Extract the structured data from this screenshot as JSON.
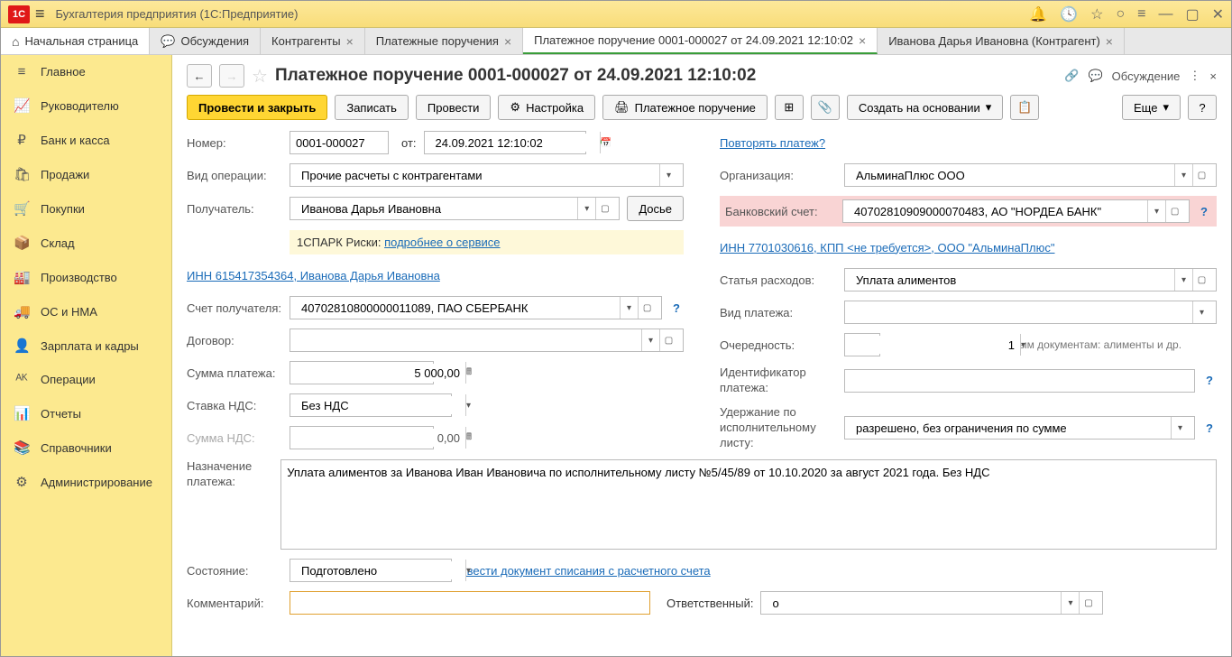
{
  "titlebar": {
    "logo": "1C",
    "title": "Бухгалтерия предприятия  (1С:Предприятие)"
  },
  "tabs": [
    {
      "label": "Начальная страница",
      "icon": "⌂",
      "home": true
    },
    {
      "label": "Обсуждения",
      "icon": "💬"
    },
    {
      "label": "Контрагенты",
      "closable": true
    },
    {
      "label": "Платежные поручения",
      "closable": true
    },
    {
      "label": "Платежное поручение 0001-000027 от 24.09.2021 12:10:02",
      "closable": true,
      "active": true
    },
    {
      "label": "Иванова Дарья Ивановна (Контрагент)",
      "closable": true
    }
  ],
  "sidebar": [
    {
      "icon": "≡",
      "label": "Главное"
    },
    {
      "icon": "📈",
      "label": "Руководителю"
    },
    {
      "icon": "₽",
      "label": "Банк и касса"
    },
    {
      "icon": "🛍",
      "label": "Продажи"
    },
    {
      "icon": "🛒",
      "label": "Покупки"
    },
    {
      "icon": "📦",
      "label": "Склад"
    },
    {
      "icon": "🏭",
      "label": "Производство"
    },
    {
      "icon": "🚚",
      "label": "ОС и НМА"
    },
    {
      "icon": "👤",
      "label": "Зарплата и кадры"
    },
    {
      "icon": "ᴬᴷ",
      "label": "Операции"
    },
    {
      "icon": "📊",
      "label": "Отчеты"
    },
    {
      "icon": "📚",
      "label": "Справочники"
    },
    {
      "icon": "⚙",
      "label": "Администрирование"
    }
  ],
  "page": {
    "title": "Платежное поручение 0001-000027 от 24.09.2021 12:10:02",
    "discuss": "Обсуждение"
  },
  "toolbar": {
    "post_close": "Провести и закрыть",
    "save": "Записать",
    "post": "Провести",
    "settings": "Настройка",
    "print": "Платежное поручение",
    "create_based": "Создать на основании",
    "more": "Еще"
  },
  "form": {
    "number_label": "Номер:",
    "number": "0001-000027",
    "from_label": "от:",
    "date": "24.09.2021 12:10:02",
    "repeat_link": "Повторять платеж?",
    "op_type_label": "Вид операции:",
    "op_type": "Прочие расчеты с контрагентами",
    "org_label": "Организация:",
    "org": "АльминаПлюс ООО",
    "recipient_label": "Получатель:",
    "recipient": "Иванова Дарья Ивановна",
    "dossier": "Досье",
    "bank_acc_label": "Банковский счет:",
    "bank_acc": "40702810909000070483, АО \"НОРДЕА БАНК\"",
    "spark_text": "1СПАРК Риски:",
    "spark_link": "подробнее о сервисе",
    "org_inn_link": "ИНН 7701030616, КПП <не требуется>, ООО \"АльминаПлюс\"",
    "recipient_inn_link": "ИНН 615417354364, Иванова Дарья Ивановна",
    "expense_label": "Статья расходов:",
    "expense": "Уплата алиментов",
    "rec_acc_label": "Счет получателя:",
    "rec_acc": "40702810800000011089, ПАО СБЕРБАНК",
    "pay_type_label": "Вид платежа:",
    "pay_type": "",
    "contract_label": "Договор:",
    "contract": "",
    "priority_label": "Очередность:",
    "priority": "1",
    "priority_hint": "Платежи по исполнительным документам: алименты и др.",
    "amount_label": "Сумма платежа:",
    "amount": "5 000,00",
    "ident_label": "Идентификатор платежа:",
    "ident": "",
    "vat_rate_label": "Ставка НДС:",
    "vat_rate": "Без НДС",
    "withhold_label": "Удержание по исполнительному листу:",
    "withhold": "разрешено, без ограничения по сумме",
    "vat_sum_label": "Сумма НДС:",
    "vat_sum": "0,00",
    "purpose_label": "Назначение платежа:",
    "purpose": "Уплата алиментов за Иванова Иван Ивановича по исполнительному листу №5/45/89 от 10.10.2020 за август 2021 года. Без НДС",
    "status_label": "Состояние:",
    "status": "Подготовлено",
    "status_link": "Ввести документ списания с расчетного счета",
    "comment_label": "Комментарий:",
    "comment": "",
    "responsible_label": "Ответственный:",
    "responsible": "о"
  }
}
